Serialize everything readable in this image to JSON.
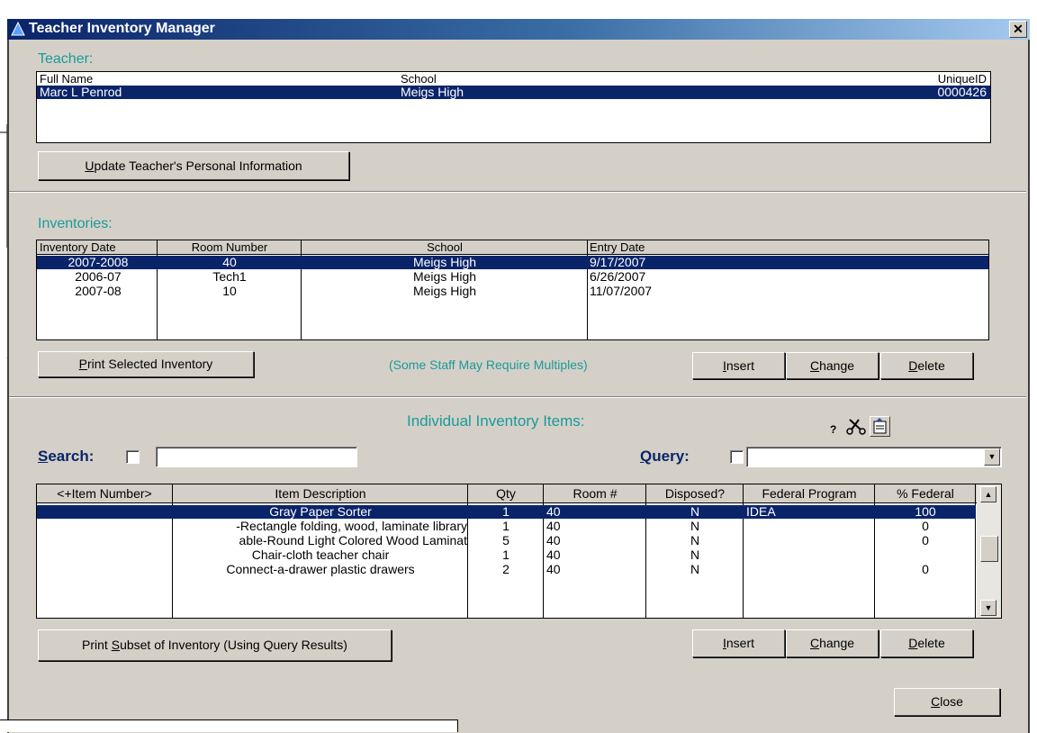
{
  "window": {
    "title": "Teacher Inventory Manager",
    "close_symbol": "✕"
  },
  "teacher": {
    "section_label": "Teacher:",
    "columns": [
      "Full Name",
      "School",
      "UniqueID"
    ],
    "row": {
      "full_name": "Marc L Penrod",
      "school": "Meigs High",
      "unique_id": "0000426"
    },
    "update_button": {
      "mnemonic": "U",
      "rest": "pdate Teacher's Personal Information"
    }
  },
  "inventories": {
    "section_label": "Inventories:",
    "columns": [
      "Inventory Date",
      "Room Number",
      "School",
      "Entry Date"
    ],
    "rows": [
      {
        "date": "2007-2008",
        "room": "40",
        "school": "Meigs High",
        "entry": "9/17/2007"
      },
      {
        "date": "2006-07",
        "room": "Tech1",
        "school": "Meigs High",
        "entry": "6/26/2007"
      },
      {
        "date": "2007-08",
        "room": "10",
        "school": "Meigs High",
        "entry": "11/07/2007"
      }
    ],
    "print_button": {
      "mnemonic": "P",
      "rest": "rint Selected Inventory"
    },
    "note": "(Some Staff May Require Multiples)",
    "insert": {
      "mnemonic": "I",
      "rest": "nsert"
    },
    "change": {
      "mnemonic": "C",
      "rest": "hange"
    },
    "delete": {
      "mnemonic": "D",
      "rest": "elete"
    }
  },
  "items": {
    "section_label": "Individual Inventory Items:",
    "help_symbol": "?",
    "search": {
      "mnemonic": "S",
      "rest": "earch:",
      "value": ""
    },
    "query": {
      "mnemonic": "Q",
      "rest": "uery:",
      "value": ""
    },
    "columns": [
      "<+Item Number>",
      "Item Description",
      "Qty",
      "Room #",
      "Disposed?",
      "Federal Program",
      "% Federal"
    ],
    "rows": [
      {
        "num": "",
        "desc": "Gray Paper Sorter",
        "qty": "1",
        "room": "40",
        "disposed": "N",
        "program": "IDEA",
        "federal": "100"
      },
      {
        "num": "",
        "desc": "-Rectangle folding, wood, laminate library",
        "qty": "1",
        "room": "40",
        "disposed": "N",
        "program": "",
        "federal": "0"
      },
      {
        "num": "",
        "desc": "able-Round Light Colored Wood Laminat",
        "qty": "5",
        "room": "40",
        "disposed": "N",
        "program": "",
        "federal": "0"
      },
      {
        "num": "",
        "desc": "Chair-cloth teacher chair",
        "qty": "1",
        "room": "40",
        "disposed": "N",
        "program": "",
        "federal": ""
      },
      {
        "num": "",
        "desc": "Connect-a-drawer plastic drawers",
        "qty": "2",
        "room": "40",
        "disposed": "N",
        "program": "",
        "federal": "0"
      }
    ],
    "print_subset": {
      "pre": "Print ",
      "mnemonic": "S",
      "rest": "ubset of Inventory (Using Query Results)"
    },
    "insert": {
      "mnemonic": "I",
      "rest": "nsert"
    },
    "change": {
      "mnemonic": "C",
      "rest": "hange"
    },
    "delete": {
      "mnemonic": "D",
      "rest": "elete"
    },
    "close": {
      "mnemonic": "C",
      "rest": "lose"
    }
  },
  "icons": {
    "scissors": "scissors-icon",
    "export": "export-icon",
    "help": "help-icon"
  },
  "colors": {
    "selection": "#0a246a",
    "teal": "#1a9a9a",
    "face": "#d4d0c8"
  }
}
